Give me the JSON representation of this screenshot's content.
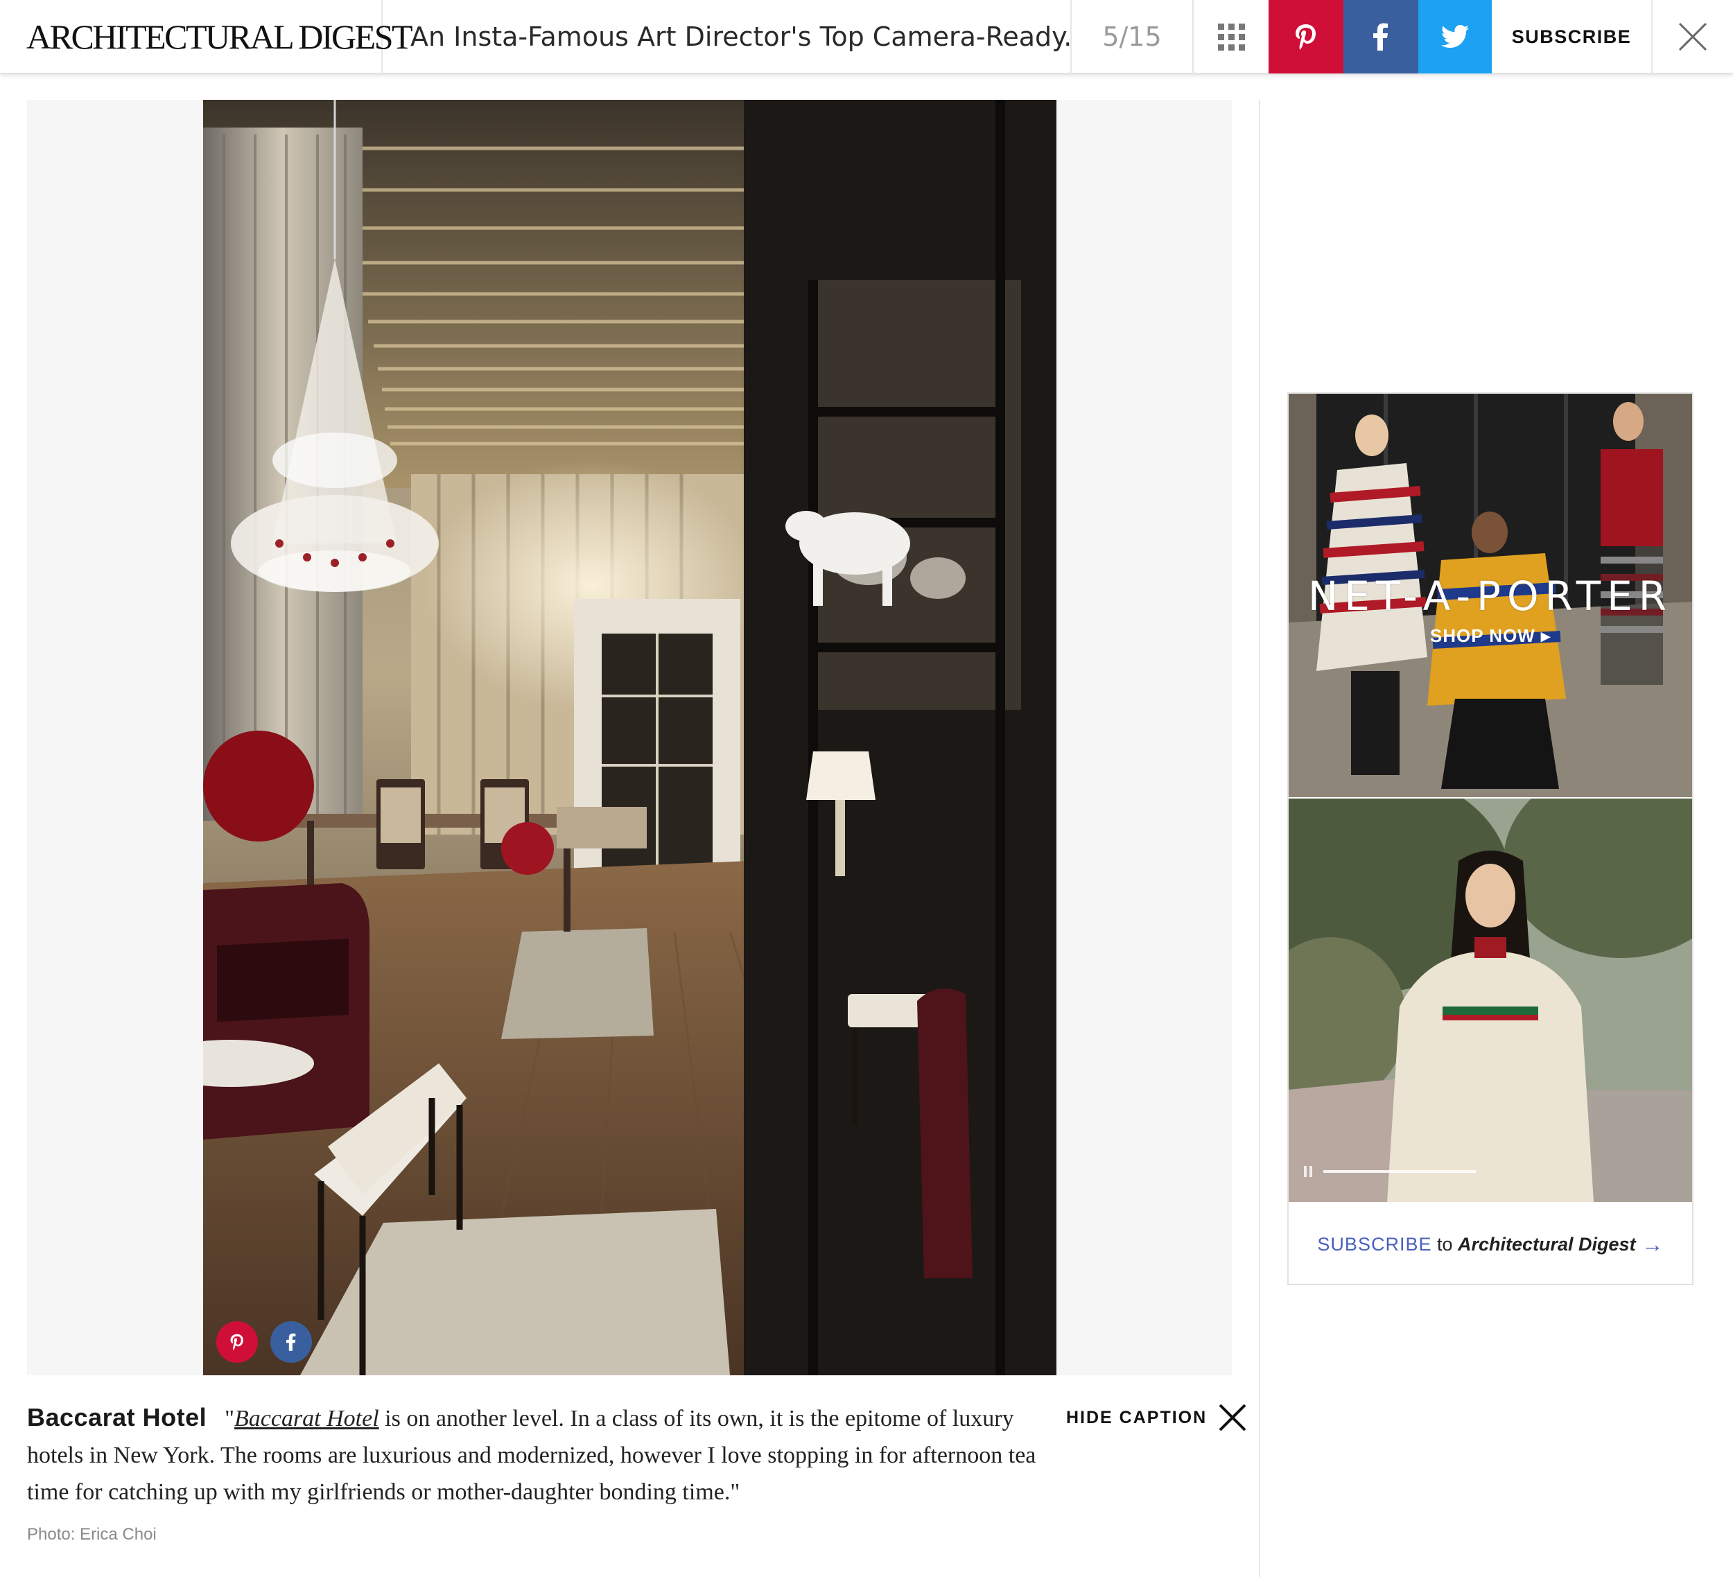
{
  "header": {
    "logo": "ARCHITECTURAL DIGEST",
    "article_title": "An Insta-Famous Art Director's Top Camera-Ready...",
    "counter": "5/15",
    "subscribe_label": "SUBSCRIBE",
    "icons": [
      "grid-icon",
      "pinterest-icon",
      "facebook-icon",
      "twitter-icon",
      "close-icon"
    ]
  },
  "slide": {
    "caption_title": "Baccarat Hotel",
    "caption_open_quote": "\"",
    "caption_link": "Baccarat Hotel",
    "caption_body": " is on another level. In a class of its own, it is the epitome of luxury hotels in New York. The rooms are luxurious and modernized, however I love stopping in for afternoon tea time for catching up with my girlfriends or mother-daughter bonding time.\"",
    "hide_caption_label": "HIDE CAPTION",
    "photo_credit": "Photo: Erica Choi"
  },
  "ad": {
    "brand": "NET-A-PORTER",
    "cta": "SHOP NOW ▸",
    "video_progress": 0.25,
    "subscribe_word": "SUBSCRIBE",
    "subscribe_to": " to ",
    "subscribe_brand": "Architectural Digest",
    "arrow": "→"
  },
  "colors": {
    "pinterest": "#cf0f38",
    "facebook": "#3a5f9e",
    "twitter": "#1da1f2",
    "subscribe_link": "#4a5fc1"
  }
}
